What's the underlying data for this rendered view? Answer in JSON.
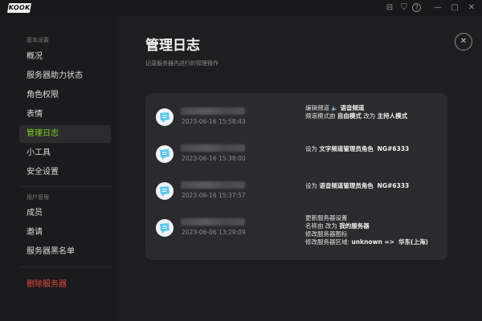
{
  "app": {
    "logo_text": "KOOK"
  },
  "titlebar": {
    "icons": [
      "archive-icon",
      "shield-icon",
      "help-icon",
      "minimize-icon",
      "maximize-icon",
      "close-icon"
    ],
    "glyphs": [
      "⊟",
      "⛉",
      "?",
      "—",
      "▢",
      "✕"
    ]
  },
  "sidebar": {
    "sections": [
      {
        "label": "基本设置"
      },
      {
        "label": "用户管理"
      }
    ],
    "items": [
      {
        "label": "概况"
      },
      {
        "label": "服务器助力状态"
      },
      {
        "label": "角色权限"
      },
      {
        "label": "表情"
      },
      {
        "label": "管理日志"
      },
      {
        "label": "小工具"
      },
      {
        "label": "安全设置"
      },
      {
        "label": "成员"
      },
      {
        "label": "邀请"
      },
      {
        "label": "服务器黑名单"
      },
      {
        "label": "删除服务器"
      }
    ],
    "active_item": "管理日志",
    "accent_color": "#7ed321",
    "danger_color": "#e0473f"
  },
  "main": {
    "title": "管理日志",
    "subtitle": "记录服务器内进行的管理操作",
    "close_glyph": "✕",
    "logs": [
      {
        "time": "2023-06-16 15:58:43",
        "line1_pre": "编辑频道",
        "line1_icon": "speaker-icon",
        "line1_bold": "语音频道",
        "line2_pre": "频道模式由 ",
        "line2_b1": "自由模式",
        "line2_mid": " 改为 ",
        "line2_b2": "主持人模式"
      },
      {
        "time": "2023-06-16 15:38:00",
        "pre": "设为 ",
        "b1": "文字频道管理员角色",
        "b2": "NG#6333"
      },
      {
        "time": "2023-06-16 15:37:57",
        "pre": "设为 ",
        "b1": "语音频道管理员角色",
        "b2": "NG#6333"
      },
      {
        "time": "2023-06-06 13:29:09",
        "line1": "更新服务器设置",
        "line2_pre": "名称由 改为 ",
        "line2_bold": "我的服务器",
        "line3": "修改服务器图标",
        "line4_pre": "修改服务器区域: ",
        "line4_b1": "unknown",
        "line4_arrow": " => ",
        "line4_b2": "华东(上海)"
      }
    ]
  }
}
